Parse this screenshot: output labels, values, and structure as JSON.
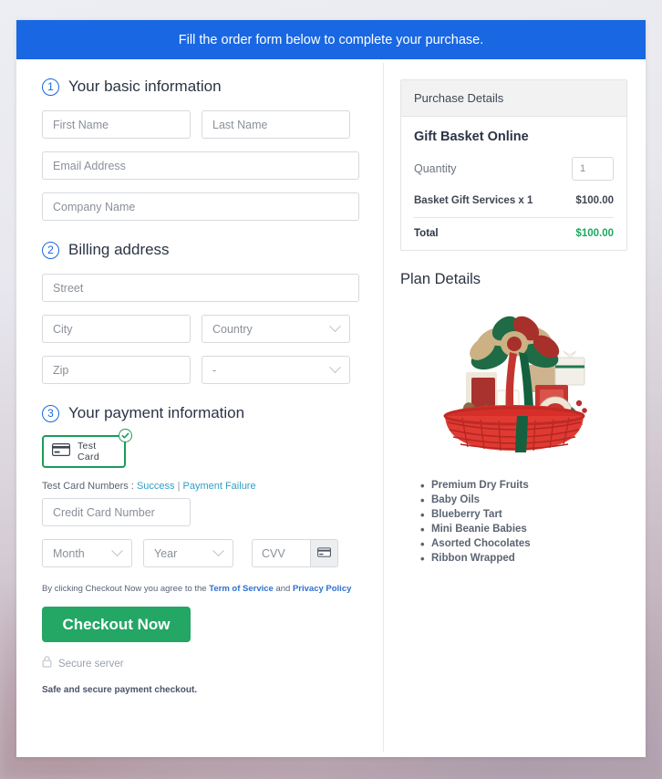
{
  "banner": {
    "text": "Fill the order form below to complete your purchase."
  },
  "sections": {
    "basic": {
      "number": "1",
      "title": "Your basic information",
      "fields": {
        "first_name": "First Name",
        "last_name": "Last Name",
        "email": "Email Address",
        "company": "Company Name"
      }
    },
    "billing": {
      "number": "2",
      "title": "Billing address",
      "fields": {
        "street": "Street",
        "city": "City",
        "country": "Country",
        "zip": "Zip",
        "state": "-"
      }
    },
    "payment": {
      "number": "3",
      "title": "Your payment information",
      "test_card_label": "Test Card",
      "test_numbers_label": "Test Card Numbers :",
      "link_success": "Success",
      "link_separator": "|",
      "link_failure": "Payment Failure",
      "fields": {
        "credit_card_number": "Credit Card Number",
        "month": "Month",
        "year": "Year",
        "cvv": "CVV"
      }
    }
  },
  "terms": {
    "prefix": "By clicking Checkout Now you agree to the",
    "term_of_service": "Term of Service",
    "and": "and",
    "privacy_policy": "Privacy Policy"
  },
  "actions": {
    "checkout_label": "Checkout Now",
    "secure_server": "Secure server",
    "safe_note": "Safe and secure payment checkout."
  },
  "purchase": {
    "header": "Purchase Details",
    "plan_name": "Gift Basket Online",
    "quantity_label": "Quantity",
    "quantity_value": "1",
    "line_item_label": "Basket Gift Services x 1",
    "line_item_amount": "$100.00",
    "total_label": "Total",
    "total_amount": "$100.00"
  },
  "plan_details": {
    "title": "Plan Details",
    "features": [
      "Premium Dry Fruits",
      "Baby Oils",
      "Blueberry Tart",
      "Mini Beanie Babies",
      "Asorted Chocolates",
      "Ribbon Wrapped"
    ]
  },
  "colors": {
    "banner_blue": "#1967e2",
    "accent_green": "#24a665",
    "total_green": "#1aa85e",
    "link_teal": "#2f9fc4",
    "link_blue": "#2f6fd0"
  }
}
